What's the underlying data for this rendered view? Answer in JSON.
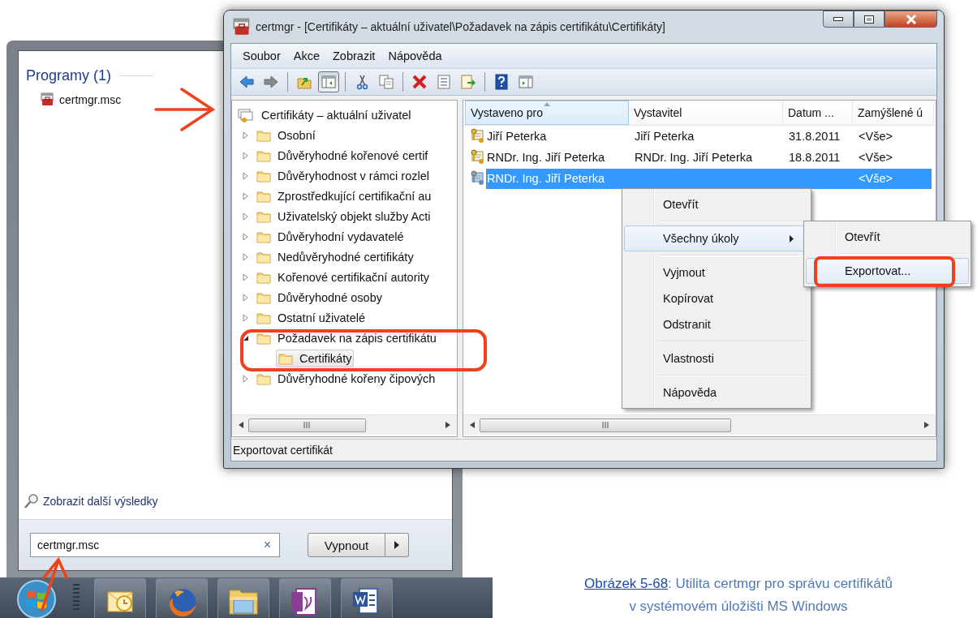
{
  "start_menu": {
    "section_title": "Programy (1)",
    "programs": [
      {
        "label": "certmgr.msc"
      }
    ],
    "more_results_link": "Zobrazit další výsledky",
    "search": {
      "value": "certmgr.msc",
      "clear": "×"
    },
    "shutdown_button": "Vypnout"
  },
  "window": {
    "title": "certmgr - [Certifikáty – aktuální uživatel\\Požadavek na zápis certifikátu\\Certifikáty]",
    "menu": [
      "Soubor",
      "Akce",
      "Zobrazit",
      "Nápověda"
    ],
    "toolbar": [
      {
        "kind": "back",
        "pressed": false
      },
      {
        "kind": "forward",
        "pressed": false
      },
      {
        "kind": "separator"
      },
      {
        "kind": "up",
        "pressed": false
      },
      {
        "kind": "tree",
        "pressed": true
      },
      {
        "kind": "separator"
      },
      {
        "kind": "cut",
        "pressed": false
      },
      {
        "kind": "copy",
        "pressed": false
      },
      {
        "kind": "separator"
      },
      {
        "kind": "delete",
        "pressed": false
      },
      {
        "kind": "properties",
        "pressed": false
      },
      {
        "kind": "export",
        "pressed": false
      },
      {
        "kind": "separator"
      },
      {
        "kind": "help",
        "pressed": false
      },
      {
        "kind": "pane",
        "pressed": false
      }
    ],
    "tree": {
      "root": "Certifikáty – aktuální uživatel",
      "items": [
        {
          "label": "Osobní",
          "expanded": false,
          "selected": false
        },
        {
          "label": "Důvěryhodné kořenové certif",
          "expanded": false,
          "selected": false
        },
        {
          "label": "Důvěryhodnost v rámci rozlel",
          "expanded": false,
          "selected": false
        },
        {
          "label": "Zprostředkující certifikační au",
          "expanded": false,
          "selected": false
        },
        {
          "label": "Uživatelský objekt služby Acti",
          "expanded": false,
          "selected": false
        },
        {
          "label": "Důvěryhodní vydavatelé",
          "expanded": false,
          "selected": false
        },
        {
          "label": "Nedůvěryhodné certifikáty",
          "expanded": false,
          "selected": false
        },
        {
          "label": "Kořenové certifikační autority",
          "expanded": false,
          "selected": false
        },
        {
          "label": "Důvěryhodné osoby",
          "expanded": false,
          "selected": false
        },
        {
          "label": "Ostatní uživatelé",
          "expanded": false,
          "selected": false
        },
        {
          "label": "Požadavek na zápis certifikátu",
          "expanded": true,
          "selected": false,
          "children": [
            {
              "label": "Certifikáty",
              "selected": true
            }
          ]
        },
        {
          "label": "Důvěryhodné kořeny čipových",
          "expanded": false,
          "selected": false
        }
      ]
    },
    "list": {
      "columns": [
        {
          "label": "Vystaveno pro",
          "sorted": true
        },
        {
          "label": "Vystavitel",
          "sorted": false
        },
        {
          "label": "Datum ...",
          "sorted": false
        },
        {
          "label": "Zamýšlené ú",
          "sorted": false
        }
      ],
      "rows": [
        {
          "issued_to": "Jiří Peterka",
          "issued_by": "Jiří Peterka",
          "date": "31.8.2011",
          "purpose": "<Vše>",
          "selected": false
        },
        {
          "issued_to": "RNDr. Ing. Jiří Peterka",
          "issued_by": "RNDr. Ing. Jiří Peterka",
          "date": "18.8.2011",
          "purpose": "<Vše>",
          "selected": false
        },
        {
          "issued_to": "RNDr. Ing. Jiří Peterka",
          "purpose": "<Vše>",
          "selected": true
        }
      ]
    },
    "status_bar": "Exportovat certifikát"
  },
  "context_menu": {
    "items": [
      {
        "kind": "item",
        "label": "Otevřít",
        "highlighted": false
      },
      {
        "kind": "separator"
      },
      {
        "kind": "submenu",
        "label": "Všechny úkoly",
        "highlighted": true
      },
      {
        "kind": "separator"
      },
      {
        "kind": "item",
        "label": "Vyjmout",
        "highlighted": false
      },
      {
        "kind": "item",
        "label": "Kopírovat",
        "highlighted": false
      },
      {
        "kind": "item",
        "label": "Odstranit",
        "highlighted": false
      },
      {
        "kind": "separator"
      },
      {
        "kind": "item",
        "label": "Vlastnosti",
        "highlighted": false
      },
      {
        "kind": "separator"
      },
      {
        "kind": "item",
        "label": "Nápověda",
        "highlighted": false
      }
    ]
  },
  "submenu": {
    "items": [
      {
        "kind": "item",
        "label": "Otevřít",
        "highlighted": false
      },
      {
        "kind": "separator"
      },
      {
        "kind": "item",
        "label": "Exportovat...",
        "highlighted": true
      }
    ]
  },
  "caption": {
    "link": "Obrázek 5-68",
    "text": ": Utilita certmgr pro správu certifikátů",
    "second_line": "v systémovém úložišti MS Windows"
  }
}
